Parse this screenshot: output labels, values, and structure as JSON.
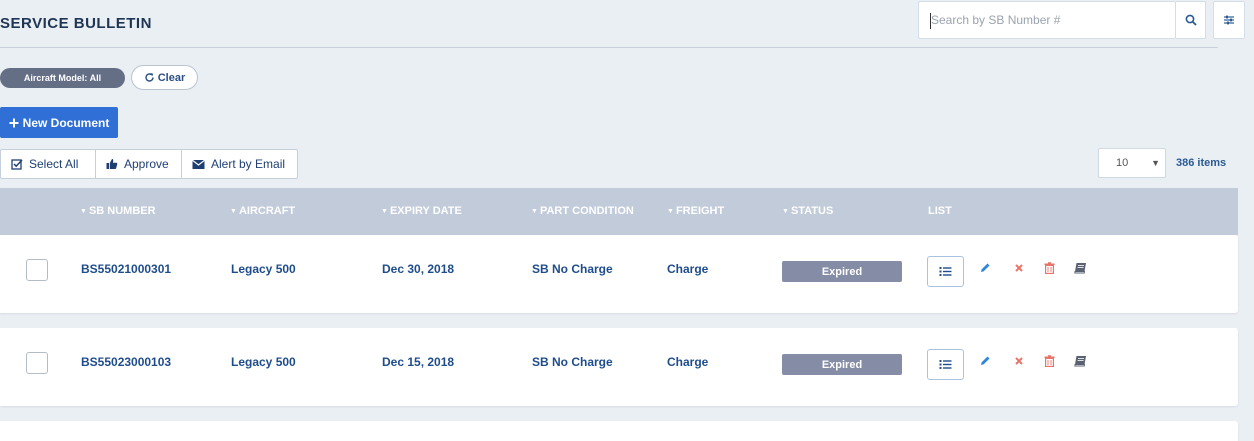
{
  "header": {
    "title": "SERVICE BULLETIN",
    "search_placeholder": "Search by SB Number #"
  },
  "filters": {
    "model_pill": "Aircraft Model: All",
    "clear_label": "Clear"
  },
  "toolbar": {
    "new_document": "New Document",
    "select_all": "Select All",
    "approve": "Approve",
    "alert_by_email": "Alert by Email"
  },
  "pagination": {
    "page_size": "10",
    "items_count": "386 items"
  },
  "table": {
    "columns": {
      "sb_number": "SB NUMBER",
      "aircraft": "AIRCRAFT",
      "expiry_date": "EXPIRY DATE",
      "part_condition": "PART CONDITION",
      "freight": "FREIGHT",
      "status": "STATUS",
      "list": "LIST"
    },
    "rows": [
      {
        "sb_number": "BS55021000301",
        "aircraft": "Legacy 500",
        "expiry_date": "Dec 30, 2018",
        "part_condition": "SB No Charge",
        "freight": "Charge",
        "status": "Expired"
      },
      {
        "sb_number": "BS55023000103",
        "aircraft": "Legacy 500",
        "expiry_date": "Dec 15, 2018",
        "part_condition": "SB No Charge",
        "freight": "Charge",
        "status": "Expired"
      }
    ]
  },
  "icons": {
    "search": "search-icon",
    "filter": "sliders-icon",
    "refresh": "refresh-icon",
    "plus": "plus-icon",
    "checkbox": "check-square-icon",
    "thumbs_up": "thumbs-up-icon",
    "envelope": "envelope-icon",
    "list": "list-icon",
    "edit": "pencil-icon",
    "cancel": "close-icon",
    "delete": "trash-icon",
    "book": "book-icon"
  },
  "colors": {
    "primary": "#2f6fd6",
    "header_bg": "#c2cbd9",
    "status_expired": "#858ca5",
    "edit": "#2e86de",
    "cancel": "#e8756b",
    "delete": "#e8756b",
    "book": "#5a6170"
  }
}
